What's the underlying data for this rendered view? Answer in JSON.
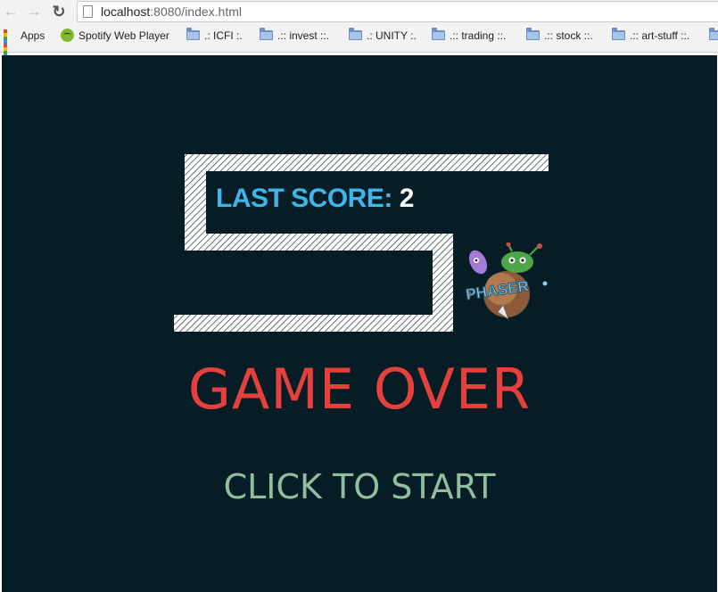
{
  "browser": {
    "url_host": "localhost",
    "url_path": ":8080/index.html",
    "bookmarks": [
      {
        "label": "Apps",
        "icon": "apps-grid-icon"
      },
      {
        "label": "Spotify Web Player",
        "icon": "spotify-icon"
      },
      {
        "label": ".: ICFI :.",
        "icon": "folder-icon"
      },
      {
        "label": ".:: invest ::.",
        "icon": "folder-icon"
      },
      {
        "label": ".: UNITY :.",
        "icon": "folder-icon"
      },
      {
        "label": ".:: trading ::.",
        "icon": "folder-icon"
      },
      {
        "label": ".:: stock ::.",
        "icon": "folder-icon"
      },
      {
        "label": ".:: art-stuff ::.",
        "icon": "folder-icon"
      }
    ]
  },
  "game": {
    "score_label": "LAST SCORE:",
    "score_value": "2",
    "logo_text": "PHASER",
    "game_over": "GAME OVER",
    "start_prompt": "CLICK TO START",
    "colors": {
      "background": "#071d25",
      "score_label": "#3fb6ea",
      "game_over": "#e5403c",
      "start_prompt": "#92bea0"
    }
  }
}
